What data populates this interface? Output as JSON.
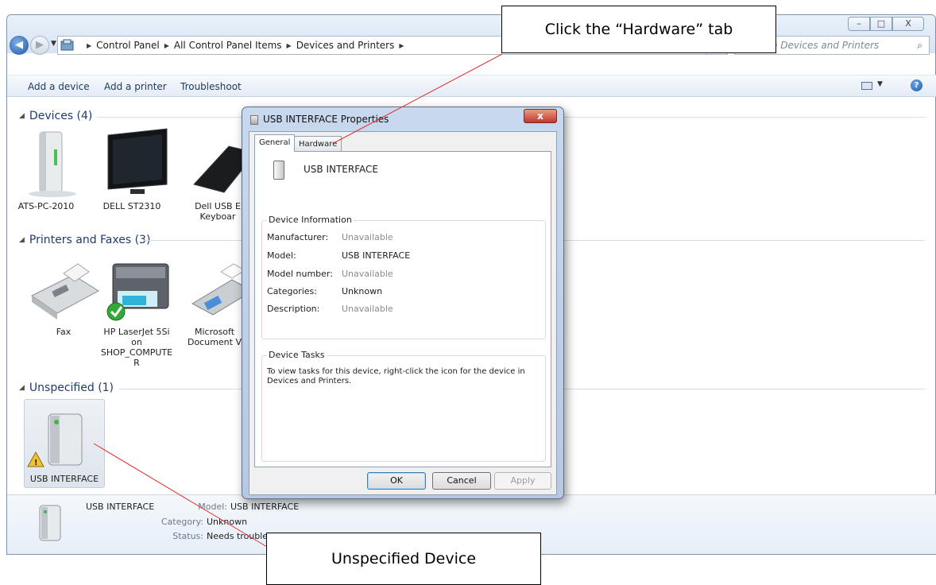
{
  "window": {
    "controls": [
      "–",
      "□",
      "X"
    ],
    "breadcrumbs": [
      "Control Panel",
      "All Control Panel Items",
      "Devices and Printers"
    ],
    "search_placeholder": "Search Devices and Printers"
  },
  "toolbar": {
    "items": [
      "Add a device",
      "Add a printer",
      "Troubleshoot"
    ]
  },
  "groups": {
    "devices": "Devices (4)",
    "printers": "Printers and Faxes (3)",
    "unspecified": "Unspecified (1)"
  },
  "devices": [
    {
      "label": "ATS-PC-2010"
    },
    {
      "label": "DELL ST2310"
    },
    {
      "label": "Dell USB E\nKeyboar"
    }
  ],
  "printers": [
    {
      "label": "Fax"
    },
    {
      "label": "HP LaserJet 5Si\non\nSHOP_COMPUTE\nR"
    },
    {
      "label": "Microsoft\nDocument V"
    }
  ],
  "unspecified": [
    {
      "label": "USB INTERFACE"
    }
  ],
  "details": {
    "name": "USB INTERFACE",
    "model_label": "Model:",
    "model": "USB INTERFACE",
    "category_label": "Category:",
    "category": "Unknown",
    "status_label": "Status:",
    "status": "Needs troubles"
  },
  "dialog": {
    "title": "USB INTERFACE Properties",
    "close": "x",
    "tabs": [
      "General",
      "Hardware"
    ],
    "device_name": "USB INTERFACE",
    "info_legend": "Device Information",
    "fields": [
      {
        "label": "Manufacturer:",
        "value": "Unavailable",
        "muted": true
      },
      {
        "label": "Model:",
        "value": "USB INTERFACE",
        "muted": false
      },
      {
        "label": "Model number:",
        "value": "Unavailable",
        "muted": true
      },
      {
        "label": "Categories:",
        "value": "Unknown",
        "muted": false
      },
      {
        "label": "Description:",
        "value": "Unavailable",
        "muted": true
      }
    ],
    "tasks_legend": "Device Tasks",
    "tasks_text": "To view tasks for this device, right-click the icon for the device in Devices and Printers.",
    "buttons": {
      "ok": "OK",
      "cancel": "Cancel",
      "apply": "Apply"
    }
  },
  "callouts": {
    "hardware": "Click the “Hardware” tab",
    "unspecified": "Unspecified Device"
  }
}
